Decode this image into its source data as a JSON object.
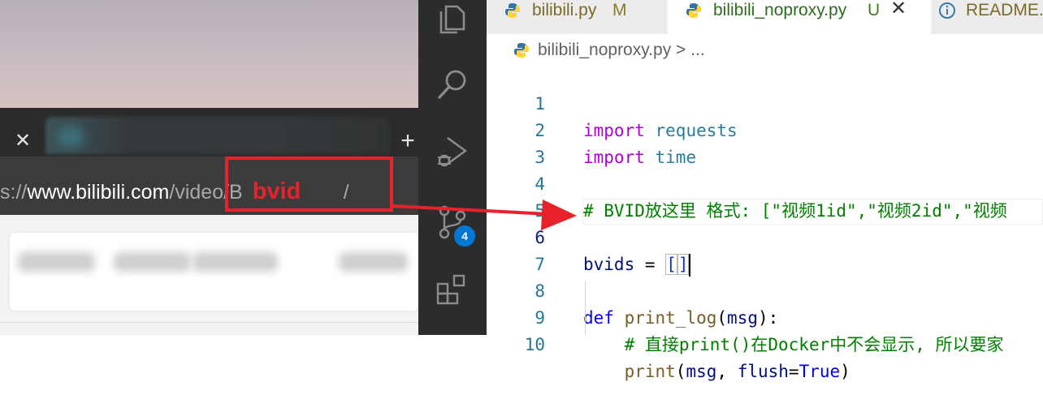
{
  "browser": {
    "tab_close_icon": "close-icon",
    "new_tab_icon": "plus-icon",
    "url": {
      "scheme_part": "s://",
      "domain": "www.bilibili.com",
      "path": "/video/B",
      "annotation": "bvid",
      "trailing": "/"
    },
    "annotation_color": "#e8222b"
  },
  "activity_bar": {
    "items": [
      "explorer-icon",
      "search-icon",
      "run-debug-icon",
      "source-control-icon",
      "extensions-icon"
    ],
    "source_control_badge": "4"
  },
  "editor": {
    "tabs": [
      {
        "label": "bilibili.py",
        "status": "M",
        "icon": "python-icon",
        "active": false
      },
      {
        "label": "bilibili_noproxy.py",
        "status": "U",
        "icon": "python-icon",
        "active": true,
        "close": "close-icon"
      },
      {
        "label": "README.m",
        "icon": "info-icon",
        "active": false
      }
    ],
    "breadcrumb": {
      "file": "bilibili_noproxy.py",
      "separator": ">",
      "rest": "..."
    },
    "lines": [
      {
        "n": "1",
        "kw": "import",
        "mod": "requests"
      },
      {
        "n": "2",
        "kw": "import",
        "mod": "time"
      },
      {
        "n": "3"
      },
      {
        "n": "4",
        "comment": "# BVID放这里 格式: [\"视频1id\",\"视频2id\",\"视频"
      },
      {
        "n": "5"
      },
      {
        "n": "6",
        "var": "bvids",
        "op": " = ",
        "open": "[",
        "close": "]"
      },
      {
        "n": "7"
      },
      {
        "n": "8",
        "kw": "def",
        "fn": "print_log",
        "p1": "(",
        "arg": "msg",
        "p2": "):"
      },
      {
        "n": "9",
        "indent": "    ",
        "comment": "# 直接print()在Docker中不会显示, 所以要家"
      },
      {
        "n": "10",
        "indent": "    ",
        "fn": "print",
        "p1": "(",
        "arg": "msg",
        "sep": ", ",
        "kwarg": "flush",
        "eq": "=",
        "val": "True",
        "p2": ")"
      }
    ]
  }
}
